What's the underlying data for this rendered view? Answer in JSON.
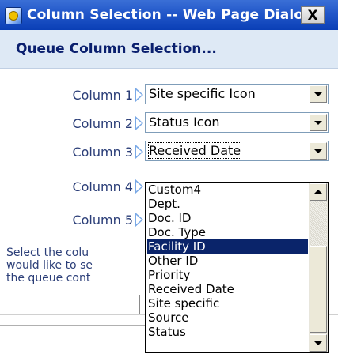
{
  "window": {
    "title": "Column Selection -- Web Page Dialog",
    "close_label": "X"
  },
  "header": {
    "heading": "Queue Column Selection..."
  },
  "columns": [
    {
      "label": "Column 1",
      "value": "Site specific Icon"
    },
    {
      "label": "Column 2",
      "value": "Status Icon"
    },
    {
      "label": "Column 3",
      "value": "Received Date"
    },
    {
      "label": "Column 4",
      "value": ""
    },
    {
      "label": "Column 5",
      "value": ""
    }
  ],
  "instructions": {
    "line1": "Select the colu",
    "line2": "would like to se",
    "line3": "the queue cont"
  },
  "dropdown": {
    "selected_index": 4,
    "options": [
      "Custom4",
      "Dept.",
      "Doc. ID",
      "Doc. Type",
      "Facility ID",
      "Other ID",
      "Priority",
      "Received Date",
      "Site specific",
      "Source",
      "Status"
    ]
  },
  "colors": {
    "titlebar": "#2257c9",
    "header_background": "#dee9f5",
    "heading_text": "#0a1f6e",
    "label_text": "#2b3e78",
    "selection": "#0a246a"
  }
}
